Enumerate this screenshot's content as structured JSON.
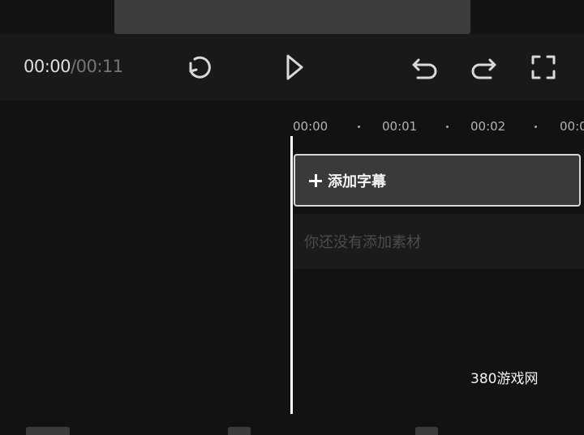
{
  "player": {
    "current_time": "00:00",
    "separator": "/",
    "duration": "00:11"
  },
  "toolbar": {
    "icons": [
      "reset-icon",
      "play-icon",
      "undo-icon",
      "redo-icon",
      "fullscreen-icon"
    ]
  },
  "timeline": {
    "ruler": [
      "00:00",
      "00:01",
      "00:02",
      "00:0"
    ],
    "caption_track_label": "添加字幕",
    "empty_material_text": "你还没有添加素材"
  },
  "watermark": "380游戏网",
  "colors": {
    "background": "#131316",
    "toolbar": "#19191c",
    "track_fill": "#3a3a3d",
    "playhead": "#ffffff"
  }
}
